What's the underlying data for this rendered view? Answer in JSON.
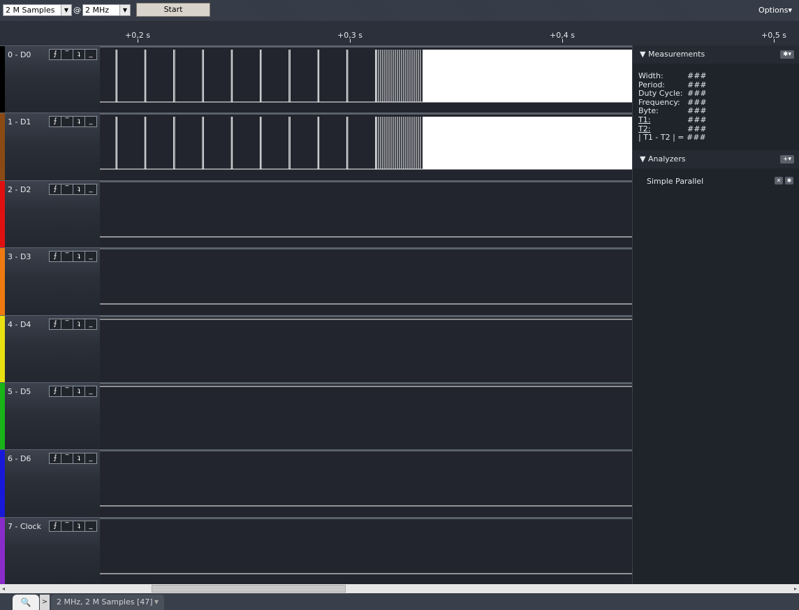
{
  "toolbar": {
    "samples_value": "2 M Samples",
    "at_symbol": "@",
    "rate_value": "2 MHz",
    "start_label": "Start",
    "options_label": "Options▾"
  },
  "ruler": {
    "ticks": [
      "+0,2 s",
      "+0,3 s",
      "+0,4 s",
      "+0,5 s"
    ]
  },
  "channels": [
    {
      "name": "0 - D0",
      "color": "#000000"
    },
    {
      "name": "1 - D1",
      "color": "#8b4a14"
    },
    {
      "name": "2 - D2",
      "color": "#e01010"
    },
    {
      "name": "3 - D3",
      "color": "#ef7b10"
    },
    {
      "name": "4 - D4",
      "color": "#e8e010"
    },
    {
      "name": "5 - D5",
      "color": "#18b418"
    },
    {
      "name": "6 - D6",
      "color": "#1818d8"
    },
    {
      "name": "7 - Clock",
      "color": "#8a2cc8"
    }
  ],
  "trigger_buttons": [
    "⨍",
    "‾",
    "ʇ",
    "_"
  ],
  "measurements": {
    "title": "Measurements",
    "rows": [
      {
        "label": "Width:",
        "value": "###"
      },
      {
        "label": "Period:",
        "value": "###"
      },
      {
        "label": "Duty Cycle:",
        "value": "###"
      },
      {
        "label": "Frequency:",
        "value": "###"
      },
      {
        "label": "Byte:",
        "value": "###"
      },
      {
        "label": "T1:",
        "value": "###"
      },
      {
        "label": "T2:",
        "value": "###"
      }
    ],
    "diff_row": "| T1 - T2 | = ###"
  },
  "analyzers": {
    "title": "Analyzers",
    "items": [
      "Simple Parallel"
    ]
  },
  "bottom_tab": {
    "session_label": "2 MHz, 2 M Samples [47]"
  }
}
